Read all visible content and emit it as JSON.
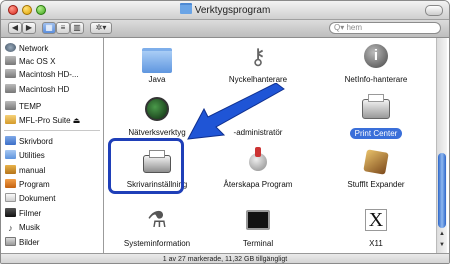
{
  "window": {
    "title": "Verktygsprogram"
  },
  "toolbar": {
    "back_glyph": "◀",
    "forward_glyph": "▶",
    "view_icon_glyph": "▦",
    "view_list_glyph": "≡",
    "view_column_glyph": "▥",
    "action_glyph": "✲▾",
    "search_placeholder": "Q▾ hem"
  },
  "sidebar": {
    "items": [
      {
        "label": "Network",
        "icon": "network-globe-icon"
      },
      {
        "label": "Mac OS X",
        "icon": "hard-drive-icon"
      },
      {
        "label": "Macintosh HD-...",
        "icon": "hard-drive-icon"
      },
      {
        "label": "Macintosh HD",
        "icon": "hard-drive-icon"
      },
      {
        "label": "TEMP",
        "icon": "hard-drive-icon"
      },
      {
        "label": "MFL-Pro Suite ⏏",
        "icon": "disk-image-icon"
      },
      {
        "label": "Skrivbord",
        "icon": "desktop-icon"
      },
      {
        "label": "Utilities",
        "icon": "folder-icon"
      },
      {
        "label": "manual",
        "icon": "home-icon"
      },
      {
        "label": "Program",
        "icon": "applications-icon"
      },
      {
        "label": "Dokument",
        "icon": "document-icon"
      },
      {
        "label": "Filmer",
        "icon": "movies-icon"
      },
      {
        "label": "Musik",
        "icon": "music-icon"
      },
      {
        "label": "Bilder",
        "icon": "pictures-icon"
      }
    ]
  },
  "content": {
    "items": [
      {
        "label": "Java",
        "icon": "folder-icon",
        "selected": false
      },
      {
        "label": "Nyckelhanterare",
        "icon": "keychain-icon",
        "selected": false
      },
      {
        "label": "NetInfo-hanterare",
        "icon": "netinfo-icon",
        "selected": false
      },
      {
        "label": "Nätverksverktyg",
        "icon": "network-utility-icon",
        "selected": false
      },
      {
        "label": "-administratör",
        "icon": "admin-icon",
        "selected": false
      },
      {
        "label": "Print Center",
        "icon": "printer-icon",
        "selected": true
      },
      {
        "label": "Skrivarinställning",
        "icon": "printer-icon",
        "selected": false
      },
      {
        "label": "Återskapa Program",
        "icon": "installer-icon",
        "selected": false
      },
      {
        "label": "StuffIt Expander",
        "icon": "stuffit-icon",
        "selected": false
      },
      {
        "label": "Systeminformation",
        "icon": "system-info-icon",
        "selected": false
      },
      {
        "label": "Terminal",
        "icon": "terminal-icon",
        "selected": false
      },
      {
        "label": "X11",
        "icon": "x11-icon",
        "selected": false
      }
    ]
  },
  "status": {
    "text": "1 av 27 markerade, 11,32 GB tillgängligt"
  },
  "colors": {
    "selection": "#3a6fd9",
    "annotation_arrow": "#1f55d6",
    "highlight_box": "#1f3fb8"
  }
}
